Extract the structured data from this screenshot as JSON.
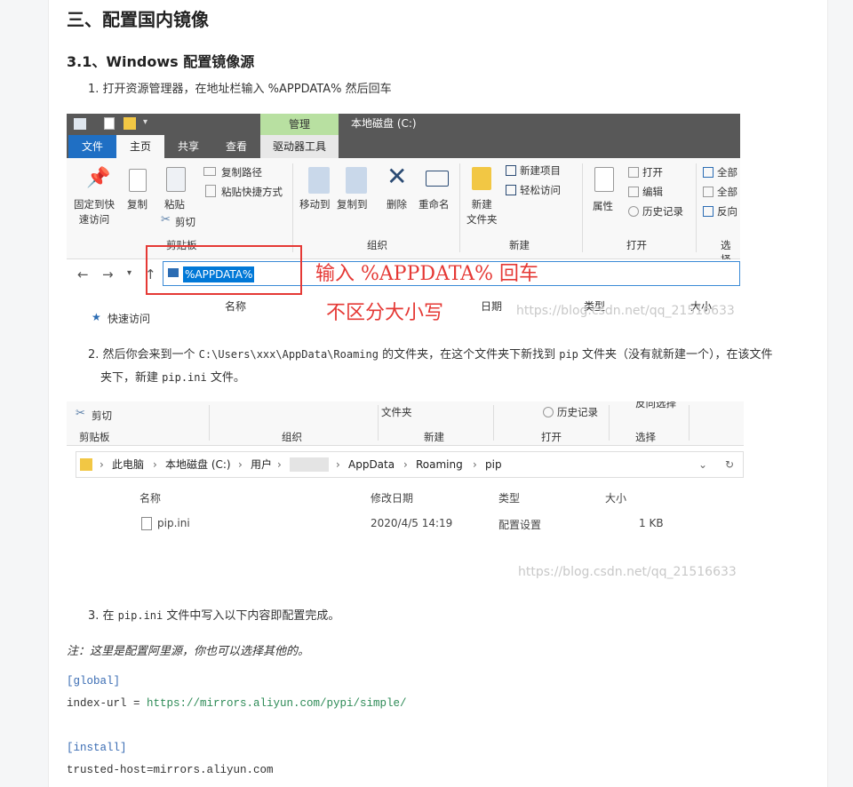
{
  "article": {
    "h_section": "三、配置国内镜像",
    "h_sub": "3.1、Windows 配置镜像源",
    "step1": "1. 打开资源管理器，在地址栏输入 %APPDATA% 然后回车",
    "step2_a": "2. 然后你会来到一个 ",
    "step2_path": "C:\\Users\\xxx\\AppData\\Roaming",
    "step2_b": " 的文件夹，在这个文件夹下新找到 ",
    "step2_pip": "pip",
    "step2_c": " 文件夹（没有就新建一个），在该文件",
    "step2_d": "夹下，新建 ",
    "step2_ini": "pip.ini",
    "step2_e": " 文件。",
    "step3_a": "3. 在 ",
    "step3_ini": "pip.ini",
    "step3_b": " 文件中写入以下内容即配置完成。",
    "note": "注：这里是配置阿里源，你也可以选择其他的。",
    "code": {
      "global": "[global]",
      "index_key": "index-url = ",
      "index_url": "https://mirrors.aliyun.com/pypi/simple/",
      "install": "[install]",
      "trusted": "trusted-host=mirrors.aliyun.com"
    }
  },
  "shot1": {
    "context_tab": "管理",
    "window_title": "本地磁盘 (C:)",
    "tabs": [
      "文件",
      "主页",
      "共享",
      "查看",
      "驱动器工具"
    ],
    "pin": "固定到快\n速访问",
    "copy": "复制",
    "paste": "粘贴",
    "copy_path": "复制路径",
    "paste_shortcut": "粘贴快捷方式",
    "cut": "剪切",
    "group_clipboard": "剪贴板",
    "move_to": "移动到",
    "copy_to": "复制到",
    "delete": "删除",
    "rename": "重命名",
    "group_organize": "组织",
    "new_folder": "新建\n文件夹",
    "new_item": "新建项目",
    "easy_access": "轻松访问",
    "group_new": "新建",
    "properties": "属性",
    "open": "打开",
    "edit": "编辑",
    "history": "历史记录",
    "group_open": "打开",
    "select_all": "全部",
    "select_none": "全部",
    "invert": "反向",
    "group_select": "选择",
    "address_value": "%APPDATA%",
    "col_name": "名称",
    "col_date": "日期",
    "col_type": "类型",
    "col_size": "大小",
    "quick_access": "快速访问",
    "annot1": "输入 %APPDATA% 回车",
    "annot2": "不区分大小写",
    "watermark": "https://blog.csdn.net/qq_21516633"
  },
  "shot2": {
    "cut": "剪切",
    "folder": "文件夹",
    "history": "历史记录",
    "invert": "反向选择",
    "group_clipboard": "剪贴板",
    "group_organize": "组织",
    "group_new": "新建",
    "group_open": "打开",
    "group_select": "选择",
    "crumbs": [
      "此电脑",
      "本地磁盘 (C:)",
      "用户",
      "AppData",
      "Roaming",
      "pip"
    ],
    "col_name": "名称",
    "col_date": "修改日期",
    "col_type": "类型",
    "col_size": "大小",
    "file_name": "pip.ini",
    "file_date": "2020/4/5 14:19",
    "file_type": "配置设置",
    "file_size": "1 KB",
    "watermark": "https://blog.csdn.net/qq_21516633"
  }
}
